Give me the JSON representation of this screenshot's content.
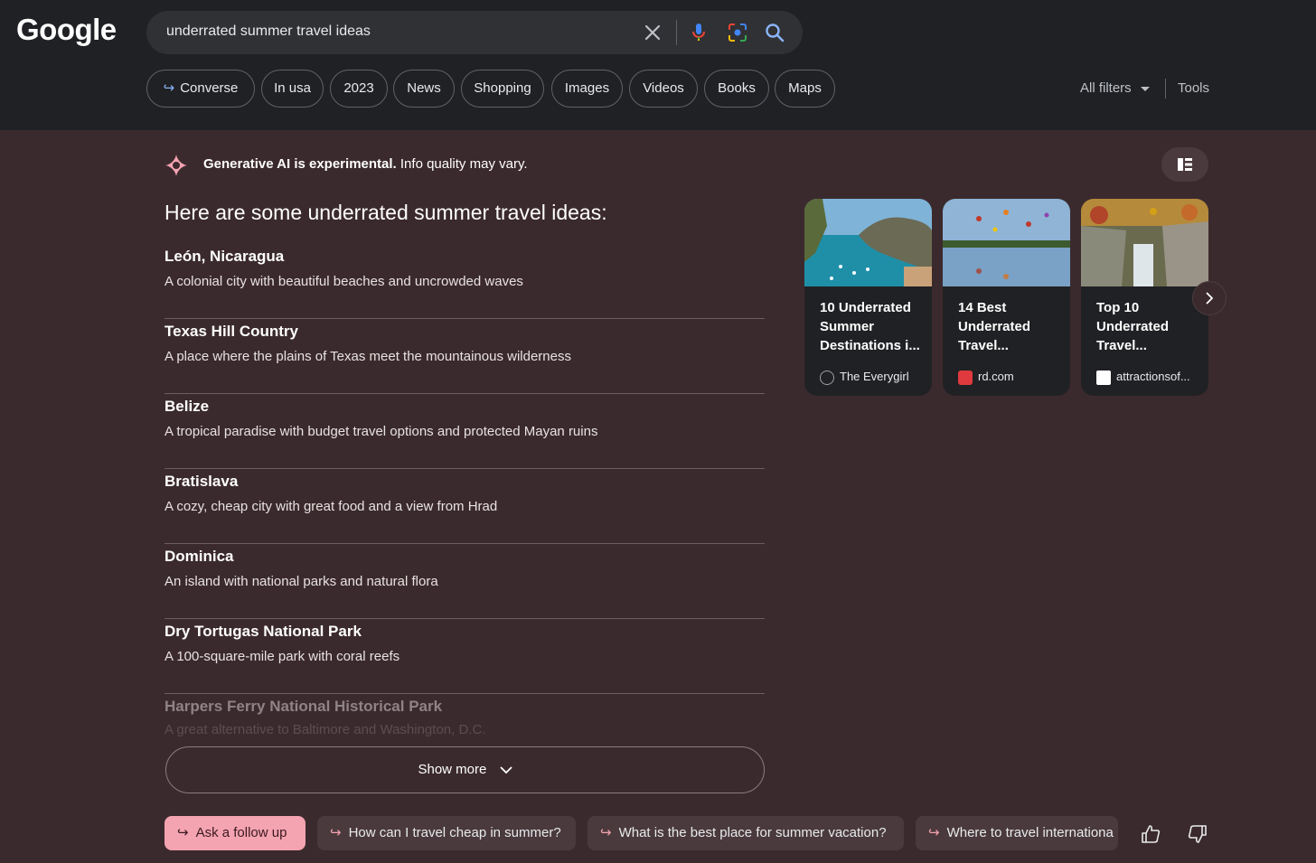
{
  "logo": "Google",
  "search": {
    "query": "underrated summer travel ideas"
  },
  "chips": [
    {
      "label": "Converse",
      "arrow": true
    },
    {
      "label": "In usa"
    },
    {
      "label": "2023"
    },
    {
      "label": "News"
    },
    {
      "label": "Shopping"
    },
    {
      "label": "Images"
    },
    {
      "label": "Videos"
    },
    {
      "label": "Books"
    },
    {
      "label": "Maps"
    }
  ],
  "filters": {
    "all_filters": "All filters",
    "tools": "Tools"
  },
  "ai": {
    "notice_bold": "Generative AI is experimental.",
    "notice_rest": " Info quality may vary.",
    "headline": "Here are some underrated summer travel ideas:"
  },
  "ideas": [
    {
      "name": "León, Nicaragua",
      "desc": "A colonial city with beautiful beaches and uncrowded waves"
    },
    {
      "name": "Texas Hill Country",
      "desc": "A place where the plains of Texas meet the mountainous wilderness"
    },
    {
      "name": "Belize",
      "desc": "A tropical paradise with budget travel options and protected Mayan ruins"
    },
    {
      "name": "Bratislava",
      "desc": "A cozy, cheap city with great food and a view from Hrad"
    },
    {
      "name": "Dominica",
      "desc": "An island with national parks and natural flora"
    },
    {
      "name": "Dry Tortugas National Park",
      "desc": "A 100-square-mile park with coral reefs"
    },
    {
      "name": "Harpers Ferry National Historical Park",
      "desc": "A great alternative to Baltimore and Washington, D.C."
    }
  ],
  "show_more": "Show more",
  "cards": [
    {
      "title": "10 Underrated Summer Destinations i...",
      "source": "The Everygirl"
    },
    {
      "title": "14 Best Underrated Travel...",
      "source": "rd.com"
    },
    {
      "title": "Top 10 Underrated Travel...",
      "source": "attractionsof..."
    }
  ],
  "followups": [
    {
      "label": "Ask a follow up",
      "primary": true
    },
    {
      "label": "How can I travel cheap in summer?"
    },
    {
      "label": "What is the best place for summer vacation?"
    },
    {
      "label": "Where to travel internationa"
    }
  ],
  "colors": {
    "page_bg": "#3b2a2d",
    "header_bg": "#202124",
    "accent_pink": "#f4a3b1",
    "link_blue": "#8ab4f8"
  }
}
